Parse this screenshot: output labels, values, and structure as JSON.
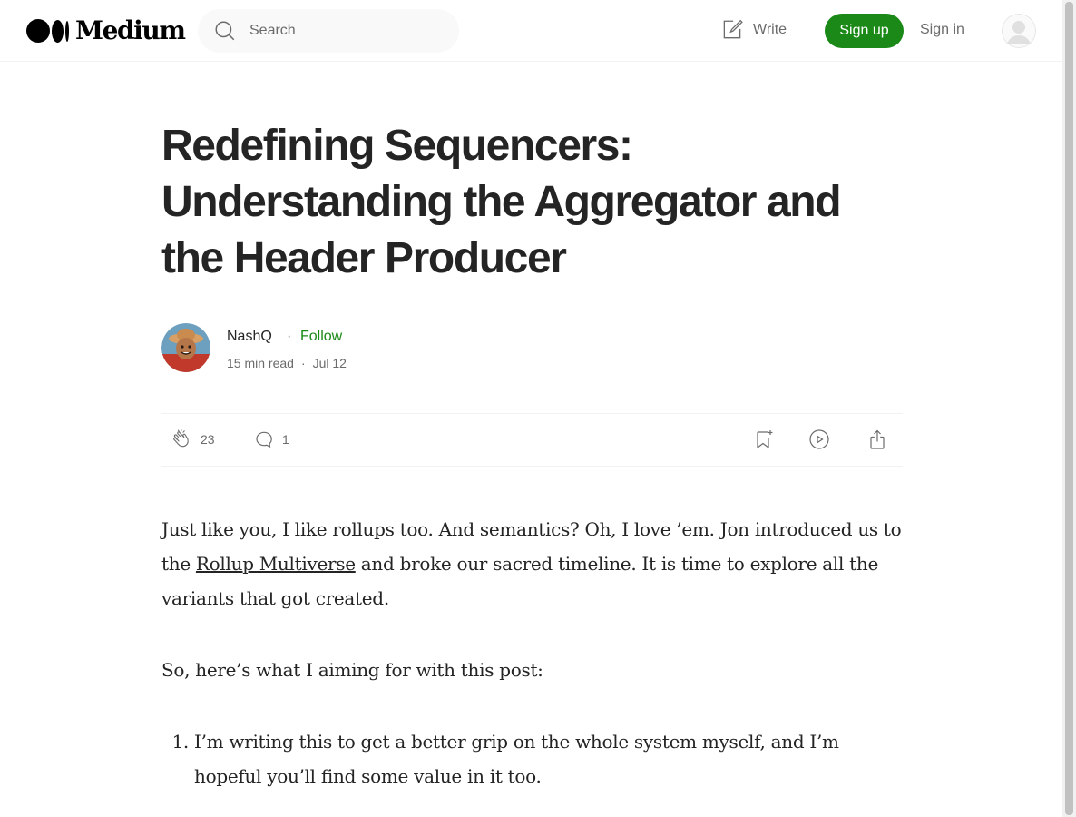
{
  "header": {
    "logo_text": "Medium",
    "search_placeholder": "Search",
    "write_label": "Write",
    "signup_label": "Sign up",
    "signin_label": "Sign in"
  },
  "article": {
    "title": "Redefining Sequencers: Understanding the Aggregator and the Header Producer",
    "author": {
      "name": "NashQ",
      "separator": "·",
      "follow_label": "Follow",
      "read_time": "15 min read",
      "date": "Jul 12"
    },
    "actions": {
      "claps": "23",
      "responses": "1"
    },
    "body": {
      "p1_before": "Just like you, I like rollups too. And semantics? Oh, I love ’em. Jon introduced us to the ",
      "p1_link": "Rollup Multiverse",
      "p1_after": " and broke our sacred timeline. It is time to explore all the variants that got created.",
      "p2": "So, here’s what I aiming for with this post:",
      "list": [
        "I’m writing this to get a better grip on the whole system myself, and I’m hopeful you’ll find some value in it too."
      ]
    }
  },
  "colors": {
    "accent_green": "#1a8917",
    "text_primary": "#242424",
    "text_secondary": "#6b6b6b"
  },
  "icons": {
    "search": "search-icon",
    "write": "write-icon",
    "clap": "clap-icon",
    "response": "response-icon",
    "bookmark": "bookmark-icon",
    "listen": "play-icon",
    "share": "share-icon"
  }
}
